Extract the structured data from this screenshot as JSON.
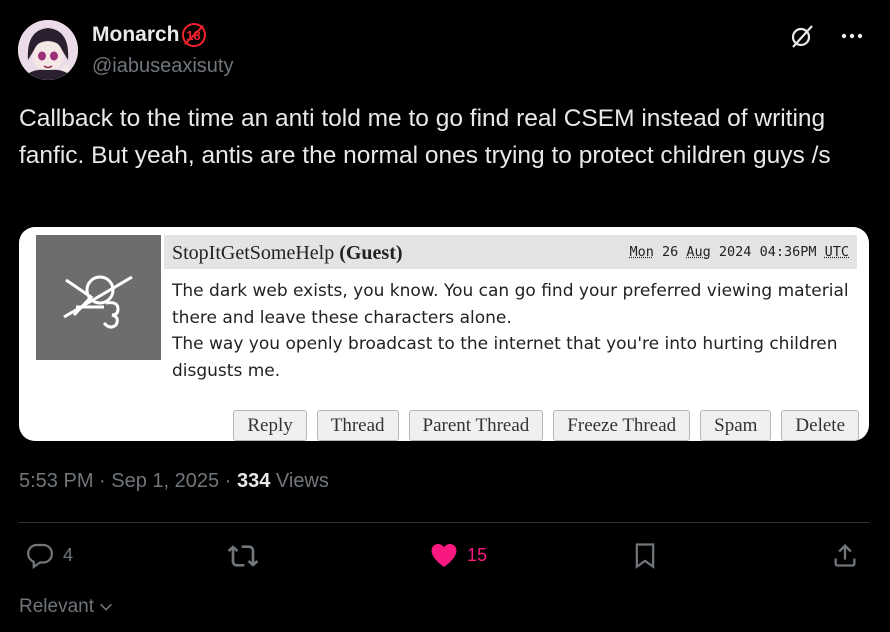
{
  "author": {
    "display_name": "Monarch",
    "age_badge": "18",
    "handle": "@iabuseaxisuty",
    "avatar_icon": "anime-avatar-icon"
  },
  "tweet": {
    "text": "Callback to the time an anti told me to go find real CSEM instead of writing fanfic. But yeah, antis are the normal ones trying to protect children guys /s",
    "time": "5:53 PM",
    "date": "Sep 1, 2025",
    "views_count": "334",
    "views_label": "Views"
  },
  "quote": {
    "author_name": "StopItGetSomeHelp",
    "author_role": "(Guest)",
    "date_parts": {
      "day": "Mon",
      "date": "26",
      "month": "Aug",
      "year": "2024",
      "time": "04:36PM",
      "tz": "UTC"
    },
    "body_line1": "The dark web exists, you know. You can go find your preferred viewing material there and leave these characters alone.",
    "body_line2": "The way you openly broadcast to the internet that you're into hurting children disgusts me.",
    "buttons": [
      "Reply",
      "Thread",
      "Parent Thread",
      "Freeze Thread",
      "Spam",
      "Delete"
    ]
  },
  "actions": {
    "reply_count": "4",
    "retweet_count": "",
    "like_count": "15",
    "like_color": "#f91880"
  },
  "sort": {
    "label": "Relevant"
  },
  "colors": {
    "background": "#000000",
    "text": "#e7e9ea",
    "muted": "#71767b",
    "badge_red": "#f4212e"
  }
}
